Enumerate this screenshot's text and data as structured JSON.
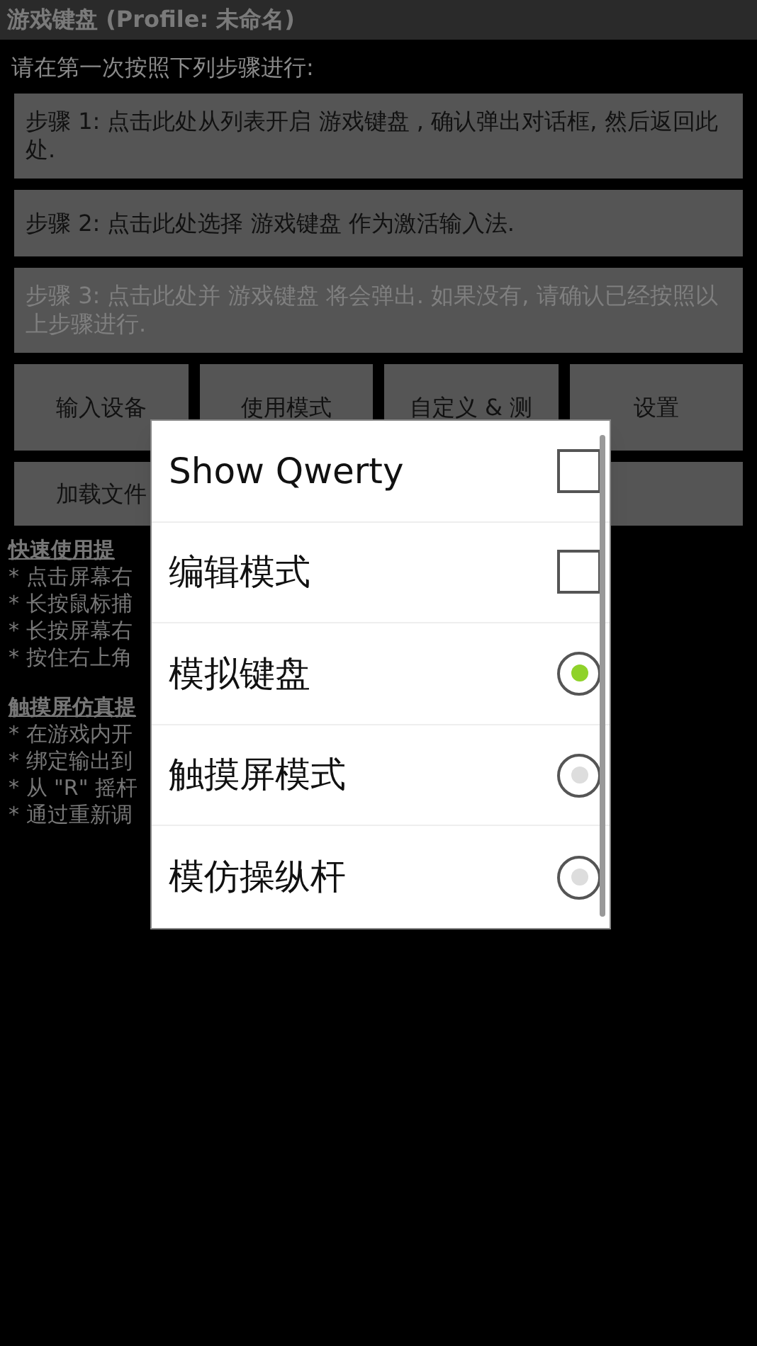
{
  "window": {
    "title": "游戏键盘 (Profile: 未命名)"
  },
  "intro": "请在第一次按照下列步骤进行:",
  "steps": [
    {
      "label": "步骤 1: 点击此处从列表开启 游戏键盘 , 确认弹出对话框, 然后返回此处.",
      "disabled": false
    },
    {
      "label": "步骤 2: 点击此处选择 游戏键盘 作为激活输入法.",
      "disabled": false
    },
    {
      "label": "步骤 3: 点击此处并 游戏键盘 将会弹出. 如果没有, 请确认已经按照以上步骤进行.",
      "disabled": true
    }
  ],
  "buttons": [
    "输入设备",
    "使用模式",
    "自定义 & 测",
    "设置",
    "加载文件"
  ],
  "tips": [
    {
      "heading": "快速使用提",
      "lines": [
        "* 点击屏幕右",
        "* 长按鼠标捕",
        "* 长按屏幕右",
        "* 按住右上角"
      ]
    },
    {
      "heading": "触摸屏仿真提",
      "lines": [
        "* 在游戏内开",
        "* 绑定输出到",
        "* 从 \"R\" 摇杆",
        "* 通过重新调"
      ]
    }
  ],
  "menu": [
    {
      "kind": "checkbox",
      "label": "Show Qwerty",
      "checked": false
    },
    {
      "kind": "checkbox",
      "label": "编辑模式",
      "checked": false
    },
    {
      "kind": "radio",
      "label": "模拟键盘",
      "selected": true
    },
    {
      "kind": "radio",
      "label": "触摸屏模式",
      "selected": false
    },
    {
      "kind": "radio",
      "label": "模仿操纵杆",
      "selected": false
    }
  ]
}
